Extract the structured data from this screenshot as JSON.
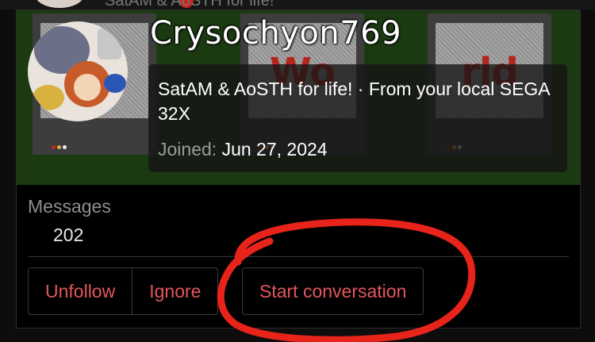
{
  "top_strip": {
    "ghost_text": "SatAM & AoSTH for life!"
  },
  "banner": {
    "tiles": [
      {
        "text": "r"
      },
      {
        "text": "Wo"
      },
      {
        "text": "rld"
      }
    ],
    "dot_colors": [
      "#c8261d",
      "#d4b43a",
      "#e8e8e8"
    ]
  },
  "profile": {
    "username": "Crysochyon769",
    "bio": "SatAM & AoSTH for life! · From your local SEGA 32X",
    "joined_label": "Joined:",
    "joined_date": "Jun 27, 2024"
  },
  "stats": {
    "messages_label": "Messages",
    "messages_value": "202"
  },
  "actions": {
    "unfollow": "Unfollow",
    "ignore": "Ignore",
    "start_conversation": "Start conversation"
  },
  "colors": {
    "action_text": "#e4565c",
    "annotation_red": "#e8231a",
    "banner_green": "#1c3a12"
  }
}
